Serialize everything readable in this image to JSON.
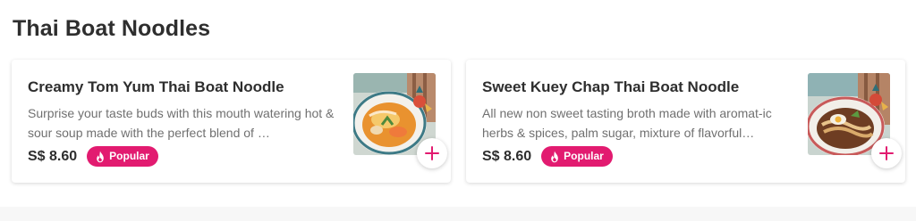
{
  "section": {
    "title": "Thai Boat Noodles"
  },
  "colors": {
    "accent": "#e21b70",
    "title_text": "#2e2e2e",
    "desc_text": "#707070"
  },
  "items": [
    {
      "name": "Creamy Tom Yum Thai Boat Noodle",
      "description": "Surprise your taste buds with this mouth watering hot & sour soup made with the perfect blend of …",
      "price": "S$ 8.60",
      "badge": "Popular",
      "badge_icon": "flame-icon",
      "add_icon": "plus-icon"
    },
    {
      "name": "Sweet Kuey Chap Thai Boat Noodle",
      "description": "All new non sweet tasting broth made with aromat-ic herbs & spices, palm sugar, mixture of flavorful…",
      "price": "S$ 8.60",
      "badge": "Popular",
      "badge_icon": "flame-icon",
      "add_icon": "plus-icon"
    }
  ]
}
